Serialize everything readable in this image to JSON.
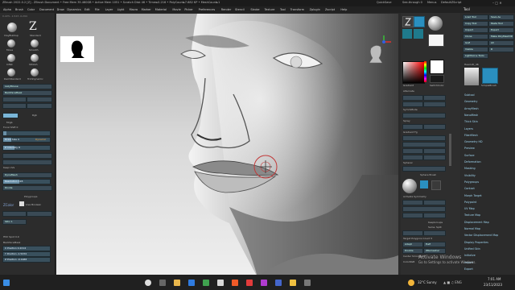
{
  "titlebar": {
    "title": "ZBrush 2022.0.2 [Z] - ZBrush Document   • Free Mem 35.460GB • Active Mem 1051 • Scratch Disk 46 • Timer▸0.216 • PolyCount▸7.682 KP • MeshCount▸1",
    "quicksave": "QuickSave",
    "see_through": "See-through  0",
    "menus_btn": "Menus",
    "default_script": "DefaultZScript"
  },
  "menubar": {
    "items": [
      "Alpha",
      "Brush",
      "Color",
      "Document",
      "Draw",
      "Dynamics",
      "Edit",
      "File",
      "Layer",
      "Light",
      "Macro",
      "Marker",
      "Material",
      "Movie",
      "Picker",
      "Preferences",
      "Render",
      "Stencil",
      "Stroke",
      "Texture",
      "Tool",
      "Transform",
      "Zplugin",
      "Zscript",
      "Help"
    ]
  },
  "coords_readout": "0.22% -1.523 -0.294",
  "left_shelf": {
    "brushes": [
      {
        "label": "ClayBuildup"
      },
      {
        "label": "Standard"
      },
      {
        "label": "Move"
      },
      {
        "label": "Smooth"
      },
      {
        "label": "Inflat"
      },
      {
        "label": "hPolish"
      },
      {
        "label": "DamStandard"
      },
      {
        "label": "TrimDynamic"
      }
    ],
    "lazy_mouse": "LazyMouse",
    "backface_mask": "BackfaceMask",
    "rgb_label": "Rgb",
    "mrgb_label": "Mrgb",
    "focal_shift": "Focal Shift  0",
    "draw_size": "Draw Size  4",
    "dynamic": "Dynamic",
    "z_intensity": "Z Intensity  8",
    "sub_label": "Sub",
    "keep_uvs": "Keep UVs",
    "dynamesh": "DynaMesh",
    "resolution": "Resolution  128",
    "divide": "Divide",
    "polygroups": "Polygroups",
    "z_color": "ZColor",
    "live_boolean": "Live Boolean",
    "sdiv": "SDiv 1",
    "backface_mask_2": "BackfaceMask",
    "positions": [
      "X Position  0.2214",
      "Y Position  -1.5234",
      "Z Position  -0.1988"
    ],
    "hide_spot": "HSV Spot  0.9"
  },
  "viewport": {
    "bg_thumbnail_alt": "head silhouette",
    "cursor_icon": "brush-cursor"
  },
  "right_panel": {
    "labels": [
      "Gradient",
      "SwitchColor",
      "Alternate",
      "SymmMode",
      "Spray",
      "Gradient Fg",
      "Spherel",
      "Sphere Brush",
      "Activate Symmetry",
      "KeepGroups",
      "Same",
      "Split",
      "Target Polygons Count  5",
      "Adapt",
      "Half",
      "Double",
      "ZRemesher",
      "Legacy (2018)",
      "KeepGroups",
      "Center Smoothing",
      "ColorRGB"
    ],
    "lightbox": "LightBox",
    "colors": [
      "#e4ff00",
      "#ff2d00",
      "#ffffff"
    ]
  },
  "tool_panel": {
    "title": "Tool",
    "buttons": [
      "Load Tool",
      "Save As",
      "Copy Tool",
      "Paste Tool",
      "Import",
      "Export",
      "Clone",
      "Make PolyMesh3D",
      "GoZ",
      "All",
      "Visible",
      "R",
      "Lightbox ▸ Tools"
    ],
    "current": "Head.ztl_46",
    "items": [
      "Subtool",
      "Geometry",
      "ArrayMesh",
      "NanoMesh",
      "Thick Skin",
      "Layers",
      "FiberMesh",
      "Geometry HD",
      "Preview",
      "Surface",
      "Deformation",
      "Masking",
      "Visibility",
      "Polygroups",
      "Contact",
      "Morph Target",
      "Polypaint",
      "UV Map",
      "Texture Map",
      "Displacement Map",
      "Normal Map",
      "Vector Displacement Map",
      "Display Properties",
      "Unified Skin",
      "Initialize",
      "Import",
      "Export"
    ],
    "mesh_label": "SimpleBrush"
  },
  "activation": {
    "title": "Activate Windows",
    "subtitle": "Go to Settings to activate Windows."
  },
  "taskbar": {
    "weather": "32°C  Sunny",
    "time": "7:01 AM",
    "date": "23/11/2023"
  }
}
